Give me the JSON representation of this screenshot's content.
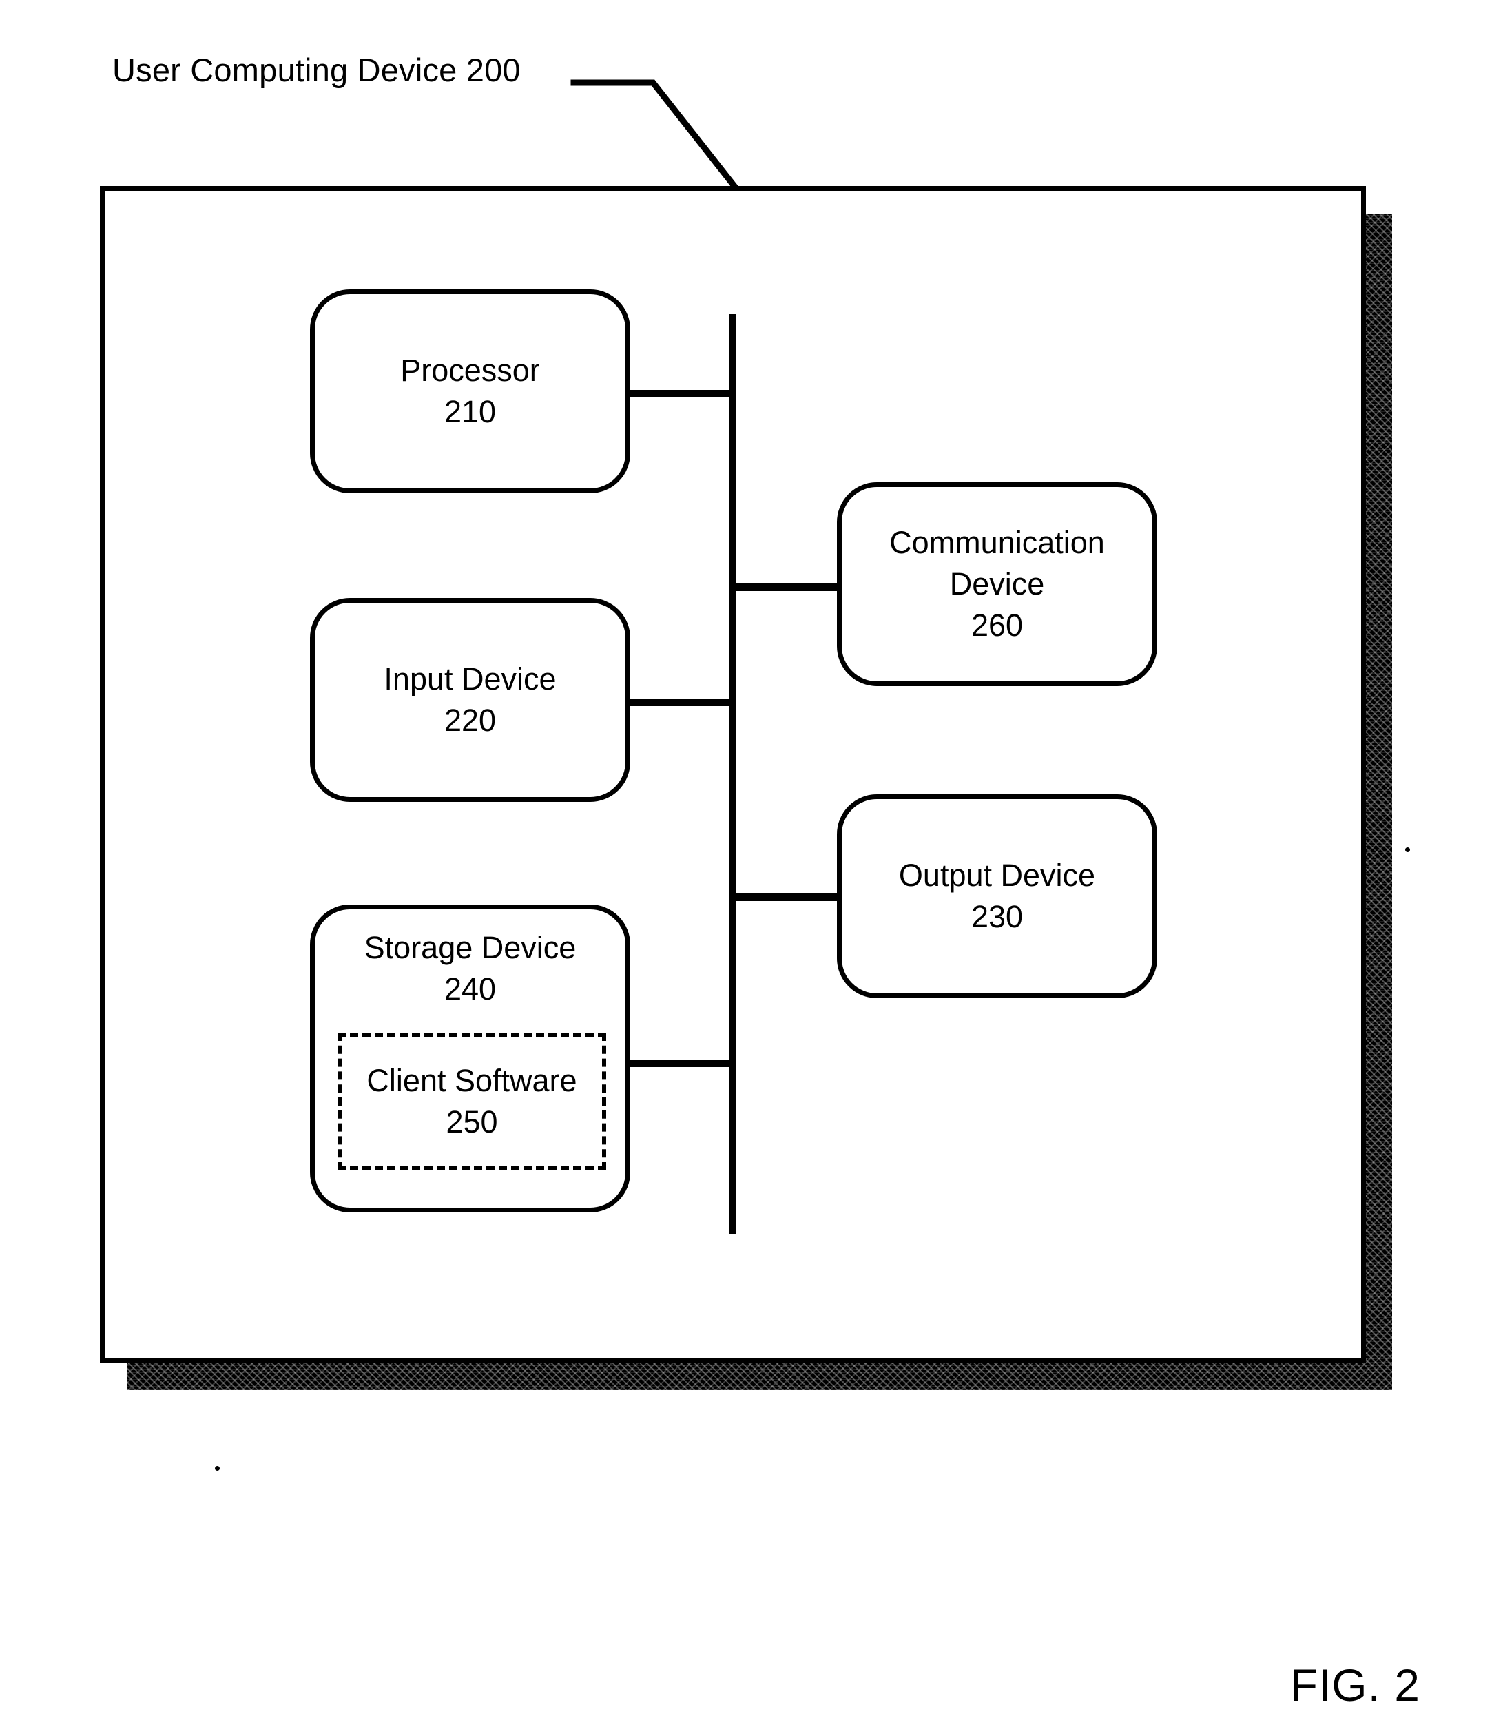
{
  "figure": {
    "number_label": "FIG. 2",
    "enclosure_label": "User Computing Device 200"
  },
  "diagram": {
    "type": "block-diagram",
    "enclosure": {
      "name": "User Computing Device",
      "reference_numeral": "200",
      "label": "User Computing Device 200"
    },
    "bus": {
      "name": "system bus",
      "orientation": "vertical"
    },
    "components": [
      {
        "id": "processor",
        "name_line": "Processor",
        "numeral_line": "210",
        "style": "rounded-solid",
        "side": "left"
      },
      {
        "id": "input-device",
        "name_line": "Input Device",
        "numeral_line": "220",
        "style": "rounded-solid",
        "side": "left"
      },
      {
        "id": "storage-device",
        "name_line": "Storage Device",
        "numeral_line": "240",
        "style": "rounded-solid",
        "side": "left"
      },
      {
        "id": "client-software",
        "name_line": "Client Software",
        "numeral_line": "250",
        "style": "dashed-rect",
        "side": "left",
        "parent": "storage-device"
      },
      {
        "id": "communication-device",
        "name_line_1": "Communication",
        "name_line_2": "Device",
        "numeral_line": "260",
        "style": "rounded-solid",
        "side": "right"
      },
      {
        "id": "output-device",
        "name_line": "Output Device",
        "numeral_line": "230",
        "style": "rounded-solid",
        "side": "right"
      }
    ]
  },
  "colors": {
    "ink": "#000000",
    "paper": "#ffffff"
  }
}
